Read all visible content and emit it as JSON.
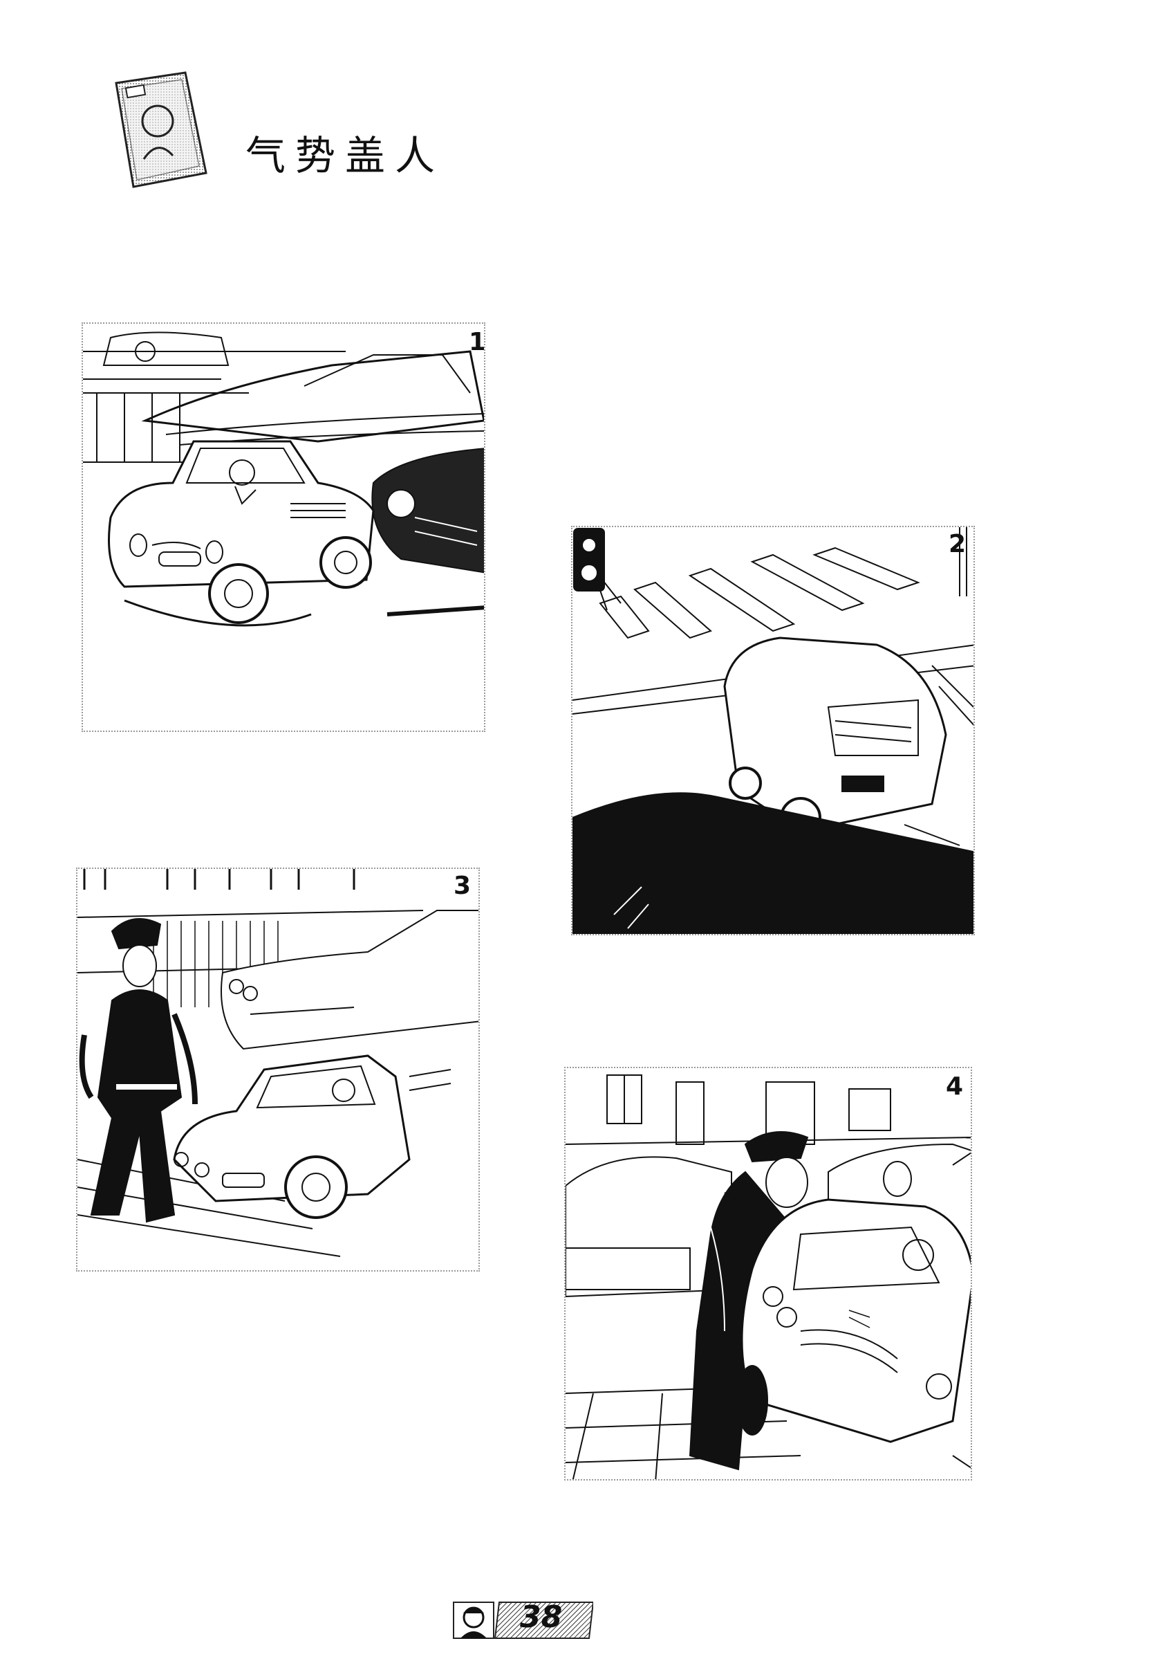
{
  "title": "气势盖人",
  "panels": [
    {
      "number": "1"
    },
    {
      "number": "2"
    },
    {
      "number": "3"
    },
    {
      "number": "4"
    }
  ],
  "page_number": "38",
  "icons": {
    "title_icon": "portrait-card-icon",
    "footer_icon": "character-head-icon"
  }
}
